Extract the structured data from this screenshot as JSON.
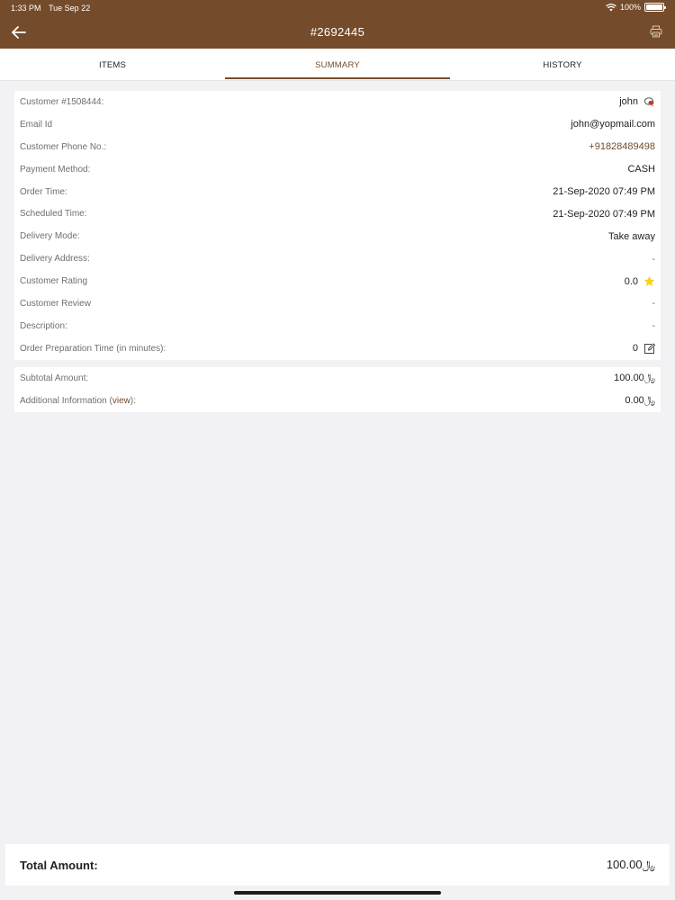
{
  "status": {
    "time": "1:33 PM",
    "date": "Tue Sep 22",
    "battery": "100%"
  },
  "header": {
    "title": "#2692445",
    "back_icon": "arrow-left-icon",
    "print_icon": "printer-icon"
  },
  "tabs": [
    {
      "label": "ITEMS",
      "active": false
    },
    {
      "label": "SUMMARY",
      "active": true
    },
    {
      "label": "HISTORY",
      "active": false
    }
  ],
  "summary": {
    "customer": {
      "label": "Customer #1508444:",
      "value": "john"
    },
    "email": {
      "label": "Email Id",
      "value": "john@yopmail.com"
    },
    "phone": {
      "label": "Customer Phone No.:",
      "value": "+91828489498"
    },
    "payment": {
      "label": "Payment Method:",
      "value": "CASH"
    },
    "order_time": {
      "label": "Order Time:",
      "value": "21-Sep-2020 07:49 PM"
    },
    "scheduled_time": {
      "label": "Scheduled Time:",
      "value": "21-Sep-2020 07:49 PM"
    },
    "delivery_mode": {
      "label": "Delivery Mode:",
      "value": "Take away"
    },
    "delivery_address": {
      "label": "Delivery Address:",
      "value": "-"
    },
    "rating": {
      "label": "Customer Rating",
      "value": "0.0"
    },
    "review": {
      "label": "Customer Review",
      "value": "-"
    },
    "description": {
      "label": "Description:",
      "value": "-"
    },
    "prep_time": {
      "label": "Order Preparation Time (in minutes):",
      "value": "0"
    }
  },
  "amounts": {
    "subtotal": {
      "label": "Subtotal Amount:",
      "value": "100.00﷼"
    },
    "additional": {
      "label_prefix": "Additional Information (",
      "link": "view",
      "label_suffix": "):",
      "value": "0.00﷼"
    }
  },
  "total": {
    "label": "Total Amount:",
    "value": "100.00﷼"
  },
  "colors": {
    "brand": "#754c2b",
    "star": "#f5d21b"
  }
}
